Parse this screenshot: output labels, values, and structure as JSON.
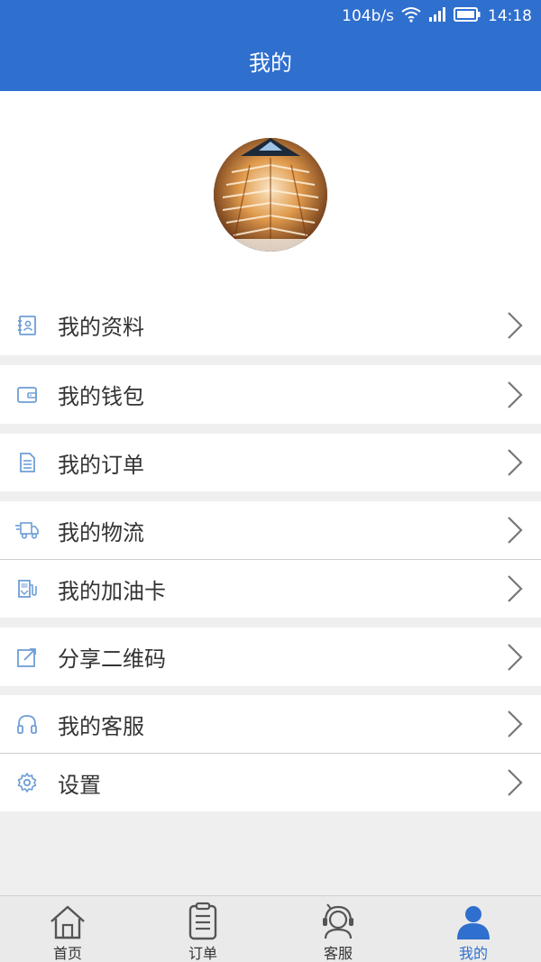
{
  "status_bar": {
    "speed": "104b/s",
    "time": "14:18"
  },
  "header": {
    "title": "我的"
  },
  "menu": {
    "items": [
      {
        "label": "我的资料",
        "icon": "contact-book-icon"
      },
      {
        "label": "我的钱包",
        "icon": "wallet-icon"
      },
      {
        "label": "我的订单",
        "icon": "document-icon"
      },
      {
        "label": "我的物流",
        "icon": "truck-icon"
      },
      {
        "label": "我的加油卡",
        "icon": "fuel-pump-icon"
      },
      {
        "label": "分享二维码",
        "icon": "share-edit-icon"
      },
      {
        "label": "我的客服",
        "icon": "headphones-icon"
      },
      {
        "label": "设置",
        "icon": "gear-icon"
      }
    ]
  },
  "tabbar": {
    "tabs": [
      {
        "label": "首页",
        "icon": "home-icon"
      },
      {
        "label": "订单",
        "icon": "clipboard-icon"
      },
      {
        "label": "客服",
        "icon": "headset-agent-icon"
      },
      {
        "label": "我的",
        "icon": "user-icon"
      }
    ],
    "active_index": 3
  },
  "colors": {
    "accent": "#2f6fce",
    "icon": "#6e9ed6",
    "background": "#efefef"
  }
}
